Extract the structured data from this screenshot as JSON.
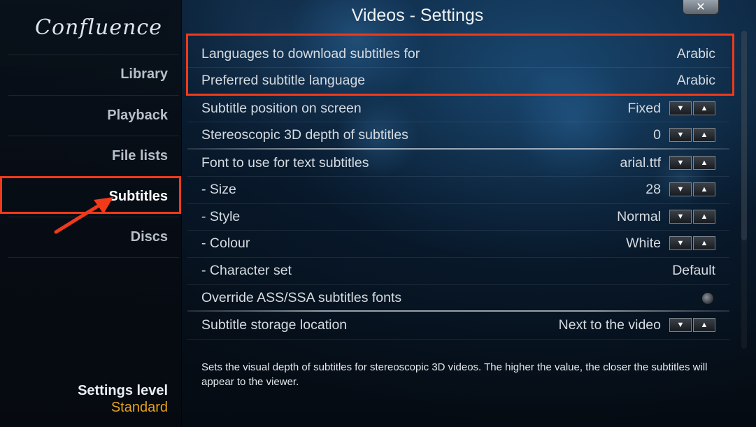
{
  "app": {
    "logo_text": "Confluence",
    "title": "Videos - Settings",
    "close_glyph": "✕"
  },
  "sidebar": {
    "items": [
      {
        "label": "Library",
        "active": false
      },
      {
        "label": "Playback",
        "active": false
      },
      {
        "label": "File lists",
        "active": false
      },
      {
        "label": "Subtitles",
        "active": true
      },
      {
        "label": "Discs",
        "active": false
      }
    ],
    "settings_level_label": "Settings level",
    "settings_level_value": "Standard"
  },
  "settings": {
    "rows": [
      {
        "label": "Languages to download subtitles for",
        "value": "Arabic",
        "control": "none"
      },
      {
        "label": "Preferred subtitle language",
        "value": "Arabic",
        "control": "none"
      },
      {
        "label": "Subtitle position on screen",
        "value": "Fixed",
        "control": "spinner"
      },
      {
        "label": "Stereoscopic 3D depth of subtitles",
        "value": "0",
        "control": "spinner"
      },
      {
        "label": "Font to use for text subtitles",
        "value": "arial.ttf",
        "control": "spinner"
      },
      {
        "label": "- Size",
        "value": "28",
        "control": "spinner"
      },
      {
        "label": "- Style",
        "value": "Normal",
        "control": "spinner"
      },
      {
        "label": "- Colour",
        "value": "White",
        "control": "spinner"
      },
      {
        "label": "- Character set",
        "value": "Default",
        "control": "none"
      },
      {
        "label": "Override ASS/SSA subtitles fonts",
        "value": "",
        "control": "radio"
      },
      {
        "label": "Subtitle storage location",
        "value": "Next to the video",
        "control": "spinner"
      }
    ],
    "spinner_down": "▼",
    "spinner_up": "▲"
  },
  "description": "Sets the visual depth of subtitles for stereoscopic 3D videos. The higher the value, the closer the subtitles will appear to the viewer.",
  "colors": {
    "annotation": "#f03a1a",
    "settings_level_value": "#e7a21a",
    "text": "#d5dbe1"
  }
}
